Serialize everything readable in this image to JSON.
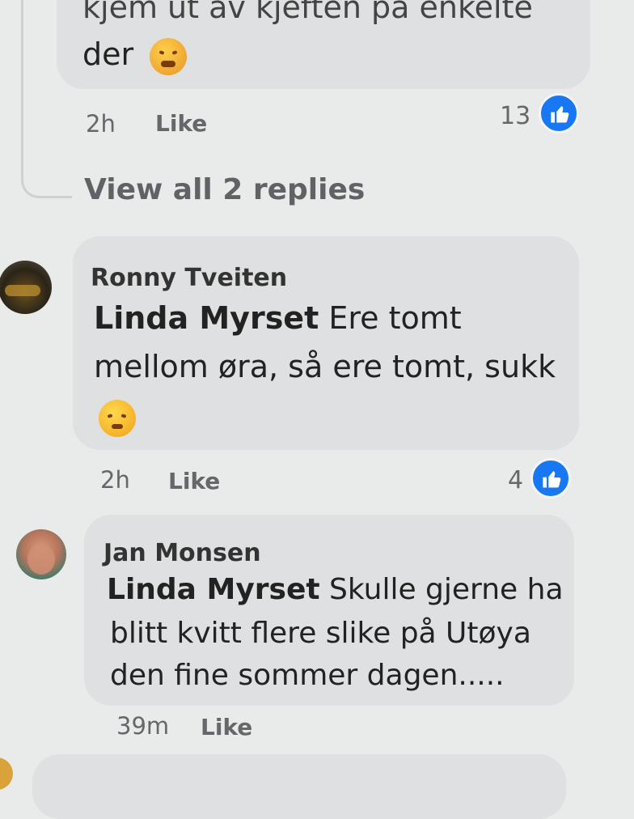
{
  "top_comment": {
    "text_partial": "kjem ut av kjeften på enkelte",
    "text_end": "der",
    "time": "2h",
    "like_label": "Like",
    "like_count": "13",
    "emoji": "angry-face"
  },
  "replies_link": "View all 2 replies",
  "comments": [
    {
      "author": "Ronny Tveiten",
      "mention": "Linda Myrset",
      "text_line1": " Ere tomt",
      "text_line2": "mellom øra, så ere tomt, sukk",
      "emoji": "sad-face",
      "time": "2h",
      "like_label": "Like",
      "like_count": "4"
    },
    {
      "author": "Jan Monsen",
      "mention": "Linda Myrset",
      "text_line1": " Skulle gjerne ha",
      "text_line2": "blitt kvitt flere slike på Utøya",
      "text_line3": "den fine sommer dagen.....",
      "time": "39m",
      "like_label": "Like"
    }
  ],
  "colors": {
    "background": "#e9eaea",
    "bubble": "#dfe0e1",
    "like_blue": "#1877f2",
    "meta_gray": "#65676b"
  }
}
